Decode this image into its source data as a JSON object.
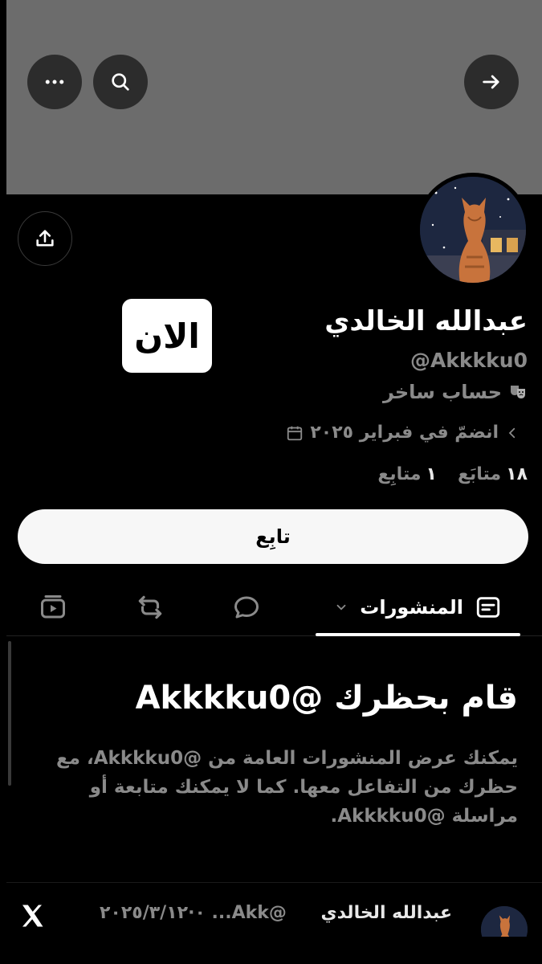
{
  "topbar": {
    "back_icon": "arrow-right-icon",
    "search_icon": "search-icon",
    "more_icon": "more-horizontal-icon"
  },
  "profile": {
    "sticker_text": "الان",
    "name": "عبدالله الخالدي",
    "handle": "@Akkkku0",
    "bio_icon": "theater-masks-icon",
    "bio": "حساب ساخر",
    "joined": "انضمّ في فبراير ٢٠٢٥",
    "following_count": "١٨",
    "following_label": "متابَع",
    "followers_count": "١",
    "followers_label": "متابِع",
    "follow_button": "تابِع"
  },
  "tabs": {
    "posts_label": "المنشورات"
  },
  "blocked": {
    "title": "قام بحظرك @Akkkku0",
    "body": "يمكنك عرض المنشورات العامة من @Akkkku0، مع حظرك من التفاعل معها. كما لا يمكنك متابعة أو مراسلة @Akkkku0."
  },
  "bottom_post": {
    "name": "عبدالله الخالدي",
    "meta": "@Akk... ٠·٢٠٢٥/٣/١٢"
  },
  "colors": {
    "background": "#000000",
    "cover": "#6c6c6c",
    "muted_text": "#8a8a8a",
    "button_bg": "#f7f7f7"
  }
}
